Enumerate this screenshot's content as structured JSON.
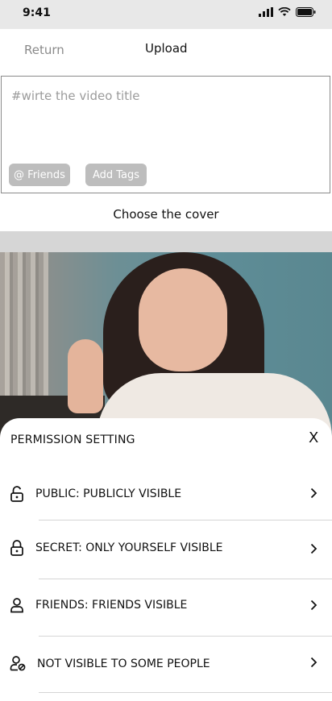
{
  "status_bar": {
    "time": "9:41"
  },
  "header": {
    "return_label": "Return",
    "title": "Upload"
  },
  "title_field": {
    "placeholder": "#wirte the video title",
    "friends_chip": "@ Friends",
    "tags_chip": "Add Tags"
  },
  "cover": {
    "choose_label": "Choose the cover"
  },
  "permission": {
    "title": "PERMISSION SETTING",
    "close": "X",
    "items": [
      {
        "label": "PUBLIC: PUBLICLY VISIBLE",
        "icon": "unlock-icon"
      },
      {
        "label": "SECRET: ONLY YOURSELF VISIBLE",
        "icon": "lock-icon"
      },
      {
        "label": "FRIENDS: FRIENDS VISIBLE",
        "icon": "user-icon"
      },
      {
        "label": "NOT VISIBLE TO SOME PEOPLE",
        "icon": "user-blocked-icon"
      }
    ]
  }
}
